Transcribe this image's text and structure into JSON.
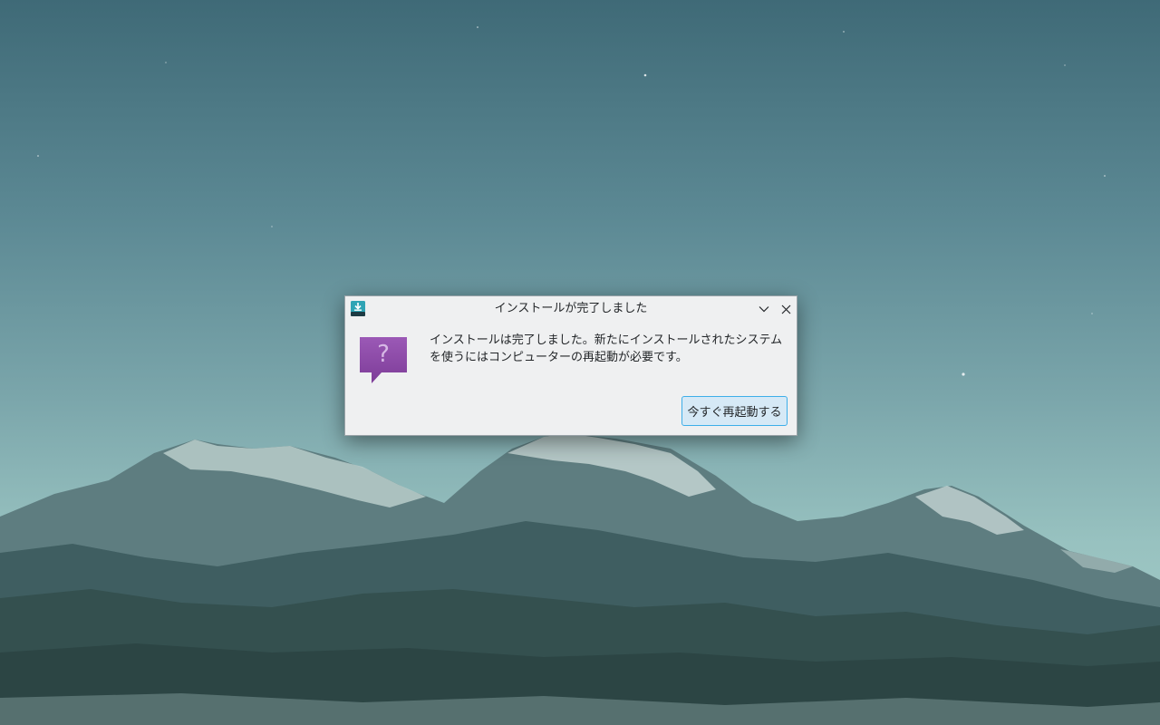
{
  "desktop": {
    "wallpaper": "mountain-lowpoly-wallpaper"
  },
  "dialog": {
    "title": "インストールが完了しました",
    "app_icon": "installer-download-icon",
    "message_line1": "インストールは完了しました。新たにインストールされたシステム",
    "message_line2": "を使うにはコンピューターの再起動が必要です。",
    "question_icon": "question-speech-bubble-icon",
    "reboot_label": "今すぐ再起動する",
    "controls": {
      "minimize_icon": "chevron-down-icon",
      "close_icon": "close-icon"
    }
  },
  "colors": {
    "accent": "#3daee9",
    "dialog_bg": "#eff0f1",
    "question_purple": "#8e44ad",
    "sky_top": "#3f6a77",
    "sky_bottom": "#a9cfca"
  }
}
